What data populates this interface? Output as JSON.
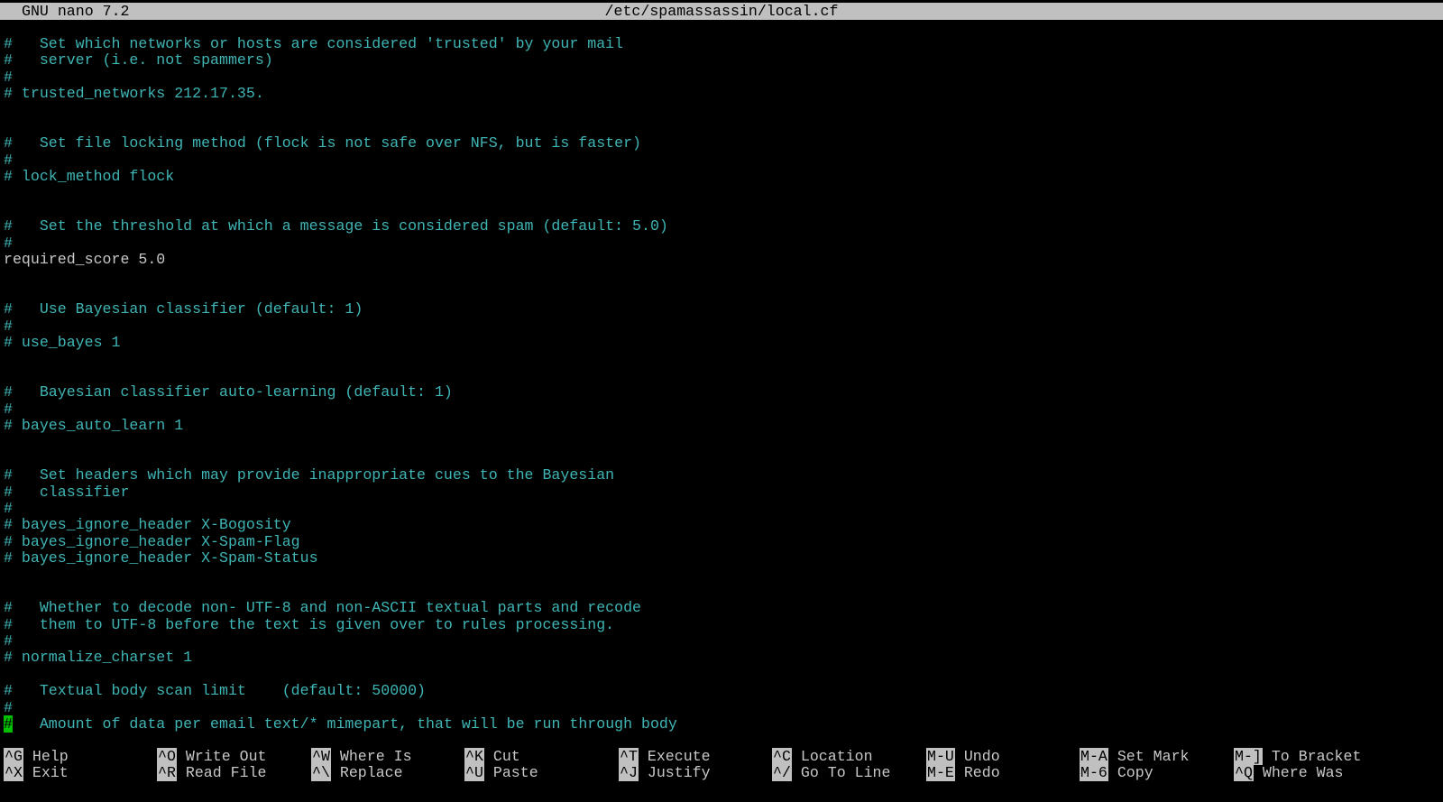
{
  "title_bar": {
    "app_name": "GNU nano 7.2",
    "file_path": "/etc/spamassassin/local.cf"
  },
  "colors": {
    "background": "#000000",
    "comment_text": "#3fb5b5",
    "plain_text": "#c8c8c8",
    "title_bar_bg": "#c0c0c0",
    "cursor": "#00c000"
  },
  "editor_lines": [
    {
      "text": "#   Set which networks or hosts are considered 'trusted' by your mail",
      "style": "comment"
    },
    {
      "text": "#   server (i.e. not spammers)",
      "style": "comment"
    },
    {
      "text": "#",
      "style": "comment"
    },
    {
      "text": "# trusted_networks 212.17.35.",
      "style": "comment"
    },
    {
      "text": "",
      "style": "comment"
    },
    {
      "text": "",
      "style": "comment"
    },
    {
      "text": "#   Set file locking method (flock is not safe over NFS, but is faster)",
      "style": "comment"
    },
    {
      "text": "#",
      "style": "comment"
    },
    {
      "text": "# lock_method flock",
      "style": "comment"
    },
    {
      "text": "",
      "style": "comment"
    },
    {
      "text": "",
      "style": "comment"
    },
    {
      "text": "#   Set the threshold at which a message is considered spam (default: 5.0)",
      "style": "comment"
    },
    {
      "text": "#",
      "style": "comment"
    },
    {
      "text": "required_score 5.0",
      "style": "plain"
    },
    {
      "text": "",
      "style": "comment"
    },
    {
      "text": "",
      "style": "comment"
    },
    {
      "text": "#   Use Bayesian classifier (default: 1)",
      "style": "comment"
    },
    {
      "text": "#",
      "style": "comment"
    },
    {
      "text": "# use_bayes 1",
      "style": "comment"
    },
    {
      "text": "",
      "style": "comment"
    },
    {
      "text": "",
      "style": "comment"
    },
    {
      "text": "#   Bayesian classifier auto-learning (default: 1)",
      "style": "comment"
    },
    {
      "text": "#",
      "style": "comment"
    },
    {
      "text": "# bayes_auto_learn 1",
      "style": "comment"
    },
    {
      "text": "",
      "style": "comment"
    },
    {
      "text": "",
      "style": "comment"
    },
    {
      "text": "#   Set headers which may provide inappropriate cues to the Bayesian",
      "style": "comment"
    },
    {
      "text": "#   classifier",
      "style": "comment"
    },
    {
      "text": "#",
      "style": "comment"
    },
    {
      "text": "# bayes_ignore_header X-Bogosity",
      "style": "comment"
    },
    {
      "text": "# bayes_ignore_header X-Spam-Flag",
      "style": "comment"
    },
    {
      "text": "# bayes_ignore_header X-Spam-Status",
      "style": "comment"
    },
    {
      "text": "",
      "style": "comment"
    },
    {
      "text": "",
      "style": "comment"
    },
    {
      "text": "#   Whether to decode non- UTF-8 and non-ASCII textual parts and recode",
      "style": "comment"
    },
    {
      "text": "#   them to UTF-8 before the text is given over to rules processing.",
      "style": "comment"
    },
    {
      "text": "#",
      "style": "comment"
    },
    {
      "text": "# normalize_charset 1",
      "style": "comment"
    },
    {
      "text": "",
      "style": "comment"
    },
    {
      "text": "#   Textual body scan limit    (default: 50000)",
      "style": "comment"
    },
    {
      "text": "#",
      "style": "comment"
    },
    {
      "text": "#   Amount of data per email text/* mimepart, that will be run through body",
      "style": "comment",
      "cursor_first_char": true
    }
  ],
  "shortcuts": {
    "row1": [
      {
        "key": "^G",
        "label": "Help"
      },
      {
        "key": "^O",
        "label": "Write Out"
      },
      {
        "key": "^W",
        "label": "Where Is"
      },
      {
        "key": "^K",
        "label": "Cut"
      },
      {
        "key": "^T",
        "label": "Execute"
      },
      {
        "key": "^C",
        "label": "Location"
      },
      {
        "key": "M-U",
        "label": "Undo"
      },
      {
        "key": "M-A",
        "label": "Set Mark"
      },
      {
        "key": "M-]",
        "label": "To Bracket"
      }
    ],
    "row2": [
      {
        "key": "^X",
        "label": "Exit"
      },
      {
        "key": "^R",
        "label": "Read File"
      },
      {
        "key": "^\\",
        "label": "Replace"
      },
      {
        "key": "^U",
        "label": "Paste"
      },
      {
        "key": "^J",
        "label": "Justify"
      },
      {
        "key": "^/",
        "label": "Go To Line"
      },
      {
        "key": "M-E",
        "label": "Redo"
      },
      {
        "key": "M-6",
        "label": "Copy"
      },
      {
        "key": "^Q",
        "label": "Where Was"
      }
    ]
  }
}
